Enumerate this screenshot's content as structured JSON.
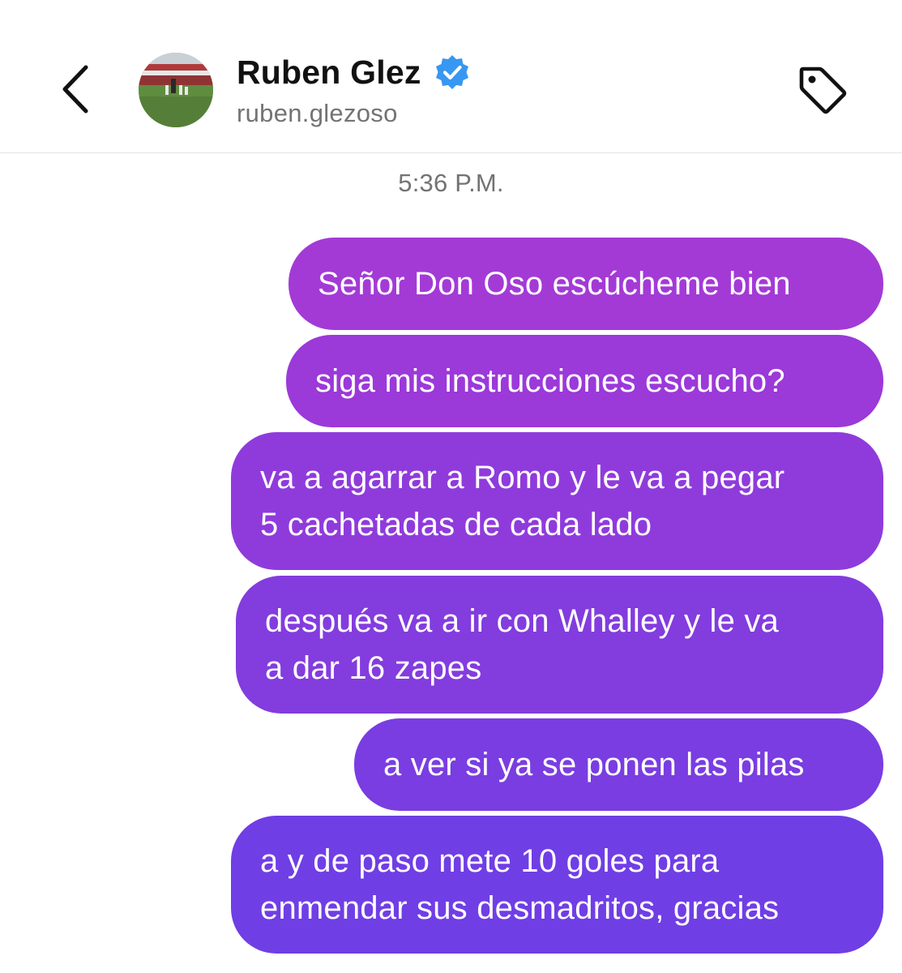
{
  "header": {
    "name": "Ruben Glez",
    "username": "ruben.glezoso",
    "verified": true,
    "icons": {
      "back": "chevron-left-icon",
      "verified": "verified-badge-icon",
      "tag": "tag-icon"
    },
    "colors": {
      "verified": "#3897f0"
    }
  },
  "timestamp": "5:36 P.M.",
  "messages": [
    {
      "text": "Señor Don Oso escúcheme bien",
      "sender": "me",
      "color": "#a33ad6"
    },
    {
      "text": "siga mis instrucciones escucho?",
      "sender": "me",
      "color": "#9b39d9"
    },
    {
      "text": "va a agarrar a Romo y le va a pegar\n5 cachetadas de cada lado",
      "sender": "me",
      "color": "#8f3bdc"
    },
    {
      "text": "después va a ir con Whalley y le va\na dar 16 zapes",
      "sender": "me",
      "color": "#833cde"
    },
    {
      "text": "a ver si ya se ponen las pilas",
      "sender": "me",
      "color": "#7a3de1"
    },
    {
      "text": "a y de paso mete 10 goles para\nenmendar sus desmadritos, gracias",
      "sender": "me",
      "color": "#703ee5"
    }
  ]
}
